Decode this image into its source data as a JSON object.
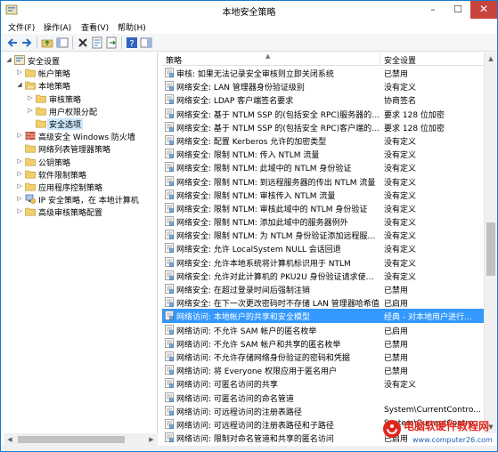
{
  "window": {
    "title": "本地安全策略"
  },
  "window_controls": {
    "minimize": "–",
    "maximize": "☐",
    "close": "✕"
  },
  "menu": [
    "文件(F)",
    "操作(A)",
    "查看(V)",
    "帮助(H)"
  ],
  "tree": [
    {
      "label": "安全设置",
      "level": 0,
      "expander": "◢",
      "icon": "security-settings-icon"
    },
    {
      "label": "帐户策略",
      "level": 1,
      "expander": "▷",
      "icon": "folder-icon"
    },
    {
      "label": "本地策略",
      "level": 1,
      "expander": "◢",
      "icon": "folder-open-icon"
    },
    {
      "label": "审核策略",
      "level": 2,
      "expander": "▷",
      "icon": "folder-icon"
    },
    {
      "label": "用户权限分配",
      "level": 2,
      "expander": "▷",
      "icon": "folder-icon"
    },
    {
      "label": "安全选项",
      "level": 2,
      "expander": "",
      "icon": "folder-icon",
      "selected": true
    },
    {
      "label": "高级安全 Windows 防火墙",
      "level": 1,
      "expander": "▷",
      "icon": "firewall-icon"
    },
    {
      "label": "网络列表管理器策略",
      "level": 1,
      "expander": "",
      "icon": "folder-icon"
    },
    {
      "label": "公钥策略",
      "level": 1,
      "expander": "▷",
      "icon": "folder-icon"
    },
    {
      "label": "软件限制策略",
      "level": 1,
      "expander": "▷",
      "icon": "folder-icon"
    },
    {
      "label": "应用程序控制策略",
      "level": 1,
      "expander": "▷",
      "icon": "folder-icon"
    },
    {
      "label": "IP 安全策略，在 本地计算机",
      "level": 1,
      "expander": "▷",
      "icon": "ip-security-icon"
    },
    {
      "label": "高级审核策略配置",
      "level": 1,
      "expander": "▷",
      "icon": "folder-icon"
    }
  ],
  "columns": {
    "policy": "策略",
    "setting": "安全设置",
    "sort_indicator": "▲"
  },
  "policies": [
    {
      "name": "审核: 如果无法记录安全审核则立即关闭系统",
      "value": "已禁用"
    },
    {
      "name": "网络安全: LAN 管理器身份验证级别",
      "value": "没有定义"
    },
    {
      "name": "网络安全: LDAP 客户端签名要求",
      "value": "协商签名"
    },
    {
      "name": "网络安全: 基于 NTLM SSP 的(包括安全 RPC)服务器的最小...",
      "value": "要求 128 位加密"
    },
    {
      "name": "网络安全: 基于 NTLM SSP 的(包括安全 RPC)客户端的最小...",
      "value": "要求 128 位加密"
    },
    {
      "name": "网络安全: 配置 Kerberos 允许的加密类型",
      "value": "没有定义"
    },
    {
      "name": "网络安全: 限制 NTLM: 传入 NTLM 流量",
      "value": "没有定义"
    },
    {
      "name": "网络安全: 限制 NTLM: 此域中的 NTLM 身份验证",
      "value": "没有定义"
    },
    {
      "name": "网络安全: 限制 NTLM: 到远程服务器的传出 NTLM 流量",
      "value": "没有定义"
    },
    {
      "name": "网络安全: 限制 NTLM: 审核传入 NTLM 流量",
      "value": "没有定义"
    },
    {
      "name": "网络安全: 限制 NTLM: 审核此域中的 NTLM 身份验证",
      "value": "没有定义"
    },
    {
      "name": "网络安全: 限制 NTLM: 添加此域中的服务器例外",
      "value": "没有定义"
    },
    {
      "name": "网络安全: 限制 NTLM: 为 NTLM 身份验证添加远程服务器...",
      "value": "没有定义"
    },
    {
      "name": "网络安全: 允许 LocalSystem NULL 会话回退",
      "value": "没有定义"
    },
    {
      "name": "网络安全: 允许本地系统将计算机标识用于 NTLM",
      "value": "没有定义"
    },
    {
      "name": "网络安全: 允许对此计算机的 PKU2U 身份验证请求使用联...",
      "value": "没有定义"
    },
    {
      "name": "网络安全: 在超过登录时间后强制注销",
      "value": "已禁用"
    },
    {
      "name": "网络安全: 在下一次更改密码时不存储 LAN 管理器哈希值",
      "value": "已启用"
    },
    {
      "name": "网络访问: 本地帐户的共享和安全模型",
      "value": "经典 - 对本地用户进行...",
      "selected": true
    },
    {
      "name": "网络访问: 不允许 SAM 帐户的匿名枚举",
      "value": "已启用"
    },
    {
      "name": "网络访问: 不允许 SAM 帐户和共享的匿名枚举",
      "value": "已禁用"
    },
    {
      "name": "网络访问: 不允许存储网络身份验证的密码和凭据",
      "value": "已禁用"
    },
    {
      "name": "网络访问: 将 Everyone 权限应用于匿名用户",
      "value": "已禁用"
    },
    {
      "name": "网络访问: 可匿名访问的共享",
      "value": "没有定义"
    },
    {
      "name": "网络访问: 可匿名访问的命名管道",
      "value": ""
    },
    {
      "name": "网络访问: 可远程访问的注册表路径",
      "value": "System\\CurrentContro..."
    },
    {
      "name": "网络访问: 可远程访问的注册表路径和子路径",
      "value": "System\\CurrentContro..."
    },
    {
      "name": "网络访问: 限制对命名管道和共享的匿名访问",
      "value": "已启用"
    }
  ],
  "scrollbar": {
    "up": "▲",
    "down": "▼",
    "left": "◀",
    "right": "▶",
    "vertical_position": 0.52
  },
  "watermark": {
    "title": "电脑软硬件教程网",
    "url": "www.computer26.com"
  },
  "colors": {
    "selection": "#3399ff",
    "tree_selection": "#cce8ff",
    "close_button": "#c7433b",
    "window_border": "#1979ca"
  }
}
